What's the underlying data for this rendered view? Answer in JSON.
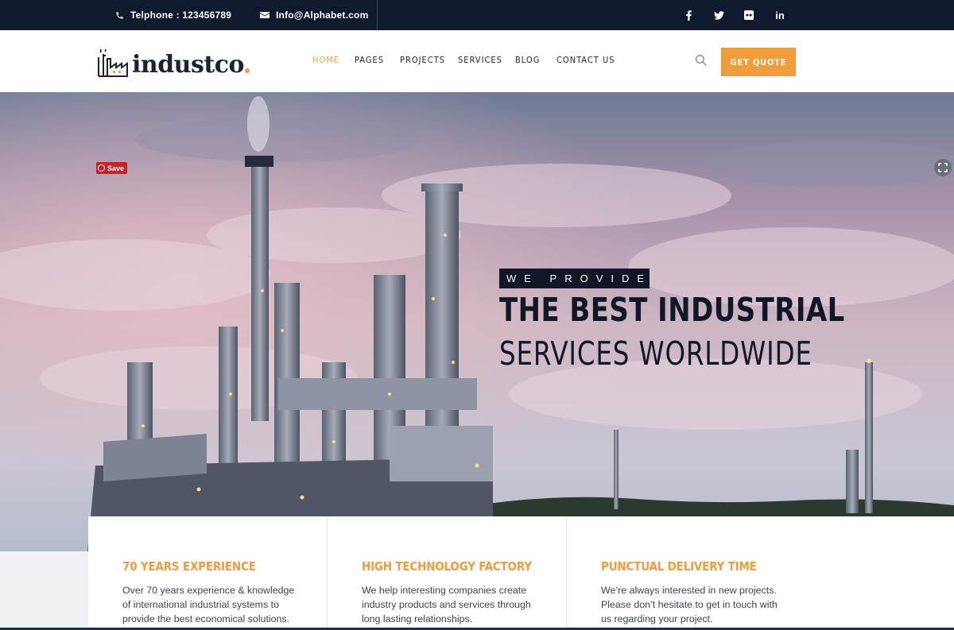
{
  "topbar": {
    "phone": "Telphone : 123456789",
    "email": "Info@Alphabet.com",
    "social_icons": [
      "facebook-icon",
      "twitter-icon",
      "flickr-icon",
      "linkedin-icon"
    ],
    "linkedin_label": "in"
  },
  "header": {
    "logo_text": "industco",
    "nav": [
      "HOME",
      "PAGES",
      "PROJECTS",
      "SERVICES",
      "BLOG",
      "CONTACT US"
    ],
    "active_nav": "HOME",
    "quote_button": "GET QUOTE"
  },
  "hero": {
    "pinterest_save": "Save",
    "badge": "WE PROVIDE",
    "title": "THE BEST INDUSTRIAL",
    "subtitle": "SERVICES WORLDWIDE"
  },
  "features": [
    {
      "title": "70 YEARS EXPERIENCE",
      "text": "Over 70 years experience & knowledge of international industrial systems to provide the best economical solutions."
    },
    {
      "title": "HIGH TECHNOLOGY FACTORY",
      "text": "We help interesting companies create industry products and services through long lasting relationships."
    },
    {
      "title": "PUNCTUAL DELIVERY TIME",
      "text": "We’re always interested in new projects. Please don’t hesitate to get in touch with us regarding your project."
    }
  ],
  "colors": {
    "accent": "#ef9d3b",
    "dark": "#0f1b2c",
    "text_dark": "#101828"
  }
}
